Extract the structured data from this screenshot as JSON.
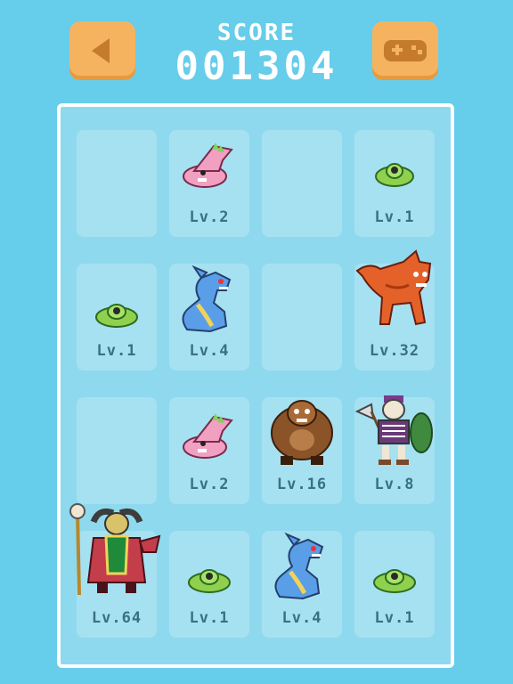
{
  "header": {
    "score_label": "SCORE",
    "score_value": "001304",
    "back_icon": "left-arrow-icon",
    "menu_icon": "gamepad-icon"
  },
  "colors": {
    "background": "#66cdea",
    "button": "#f6b35f",
    "cell": "#a6e1f2",
    "level_text": "#3b6f86"
  },
  "grid": [
    {
      "level": "",
      "monster": "none"
    },
    {
      "level": "Lv.2",
      "monster": "pink-dragon"
    },
    {
      "level": "",
      "monster": "none"
    },
    {
      "level": "Lv.1",
      "monster": "green-slime"
    },
    {
      "level": "Lv.1",
      "monster": "green-slime"
    },
    {
      "level": "Lv.4",
      "monster": "blue-dragon"
    },
    {
      "level": "",
      "monster": "none"
    },
    {
      "level": "Lv.32",
      "monster": "orange-wolf"
    },
    {
      "level": "",
      "monster": "none"
    },
    {
      "level": "Lv.2",
      "monster": "pink-dragon"
    },
    {
      "level": "Lv.16",
      "monster": "brown-ogre"
    },
    {
      "level": "Lv.8",
      "monster": "skeleton-warrior"
    },
    {
      "level": "Lv.64",
      "monster": "demon-shaman"
    },
    {
      "level": "Lv.1",
      "monster": "green-slime"
    },
    {
      "level": "Lv.4",
      "monster": "blue-dragon"
    },
    {
      "level": "Lv.1",
      "monster": "green-slime"
    }
  ]
}
